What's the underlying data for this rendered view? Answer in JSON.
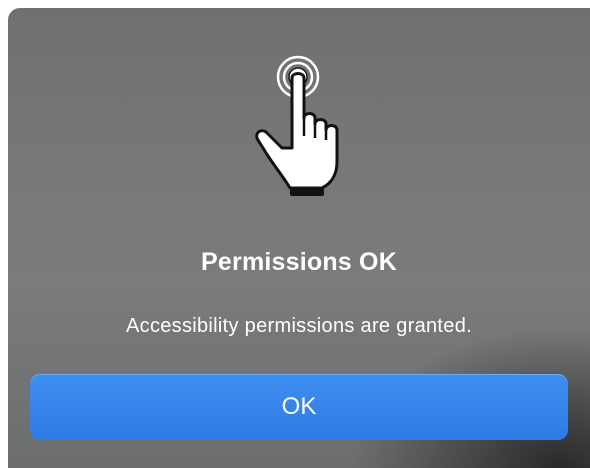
{
  "dialog": {
    "icon": "pointing-hand-tap-icon",
    "title": "Permissions OK",
    "message": "Accessibility permissions are granted.",
    "ok_label": "OK"
  },
  "colors": {
    "button_blue": "#2f7be6",
    "background_gray": "#777877",
    "text": "#ffffff"
  }
}
